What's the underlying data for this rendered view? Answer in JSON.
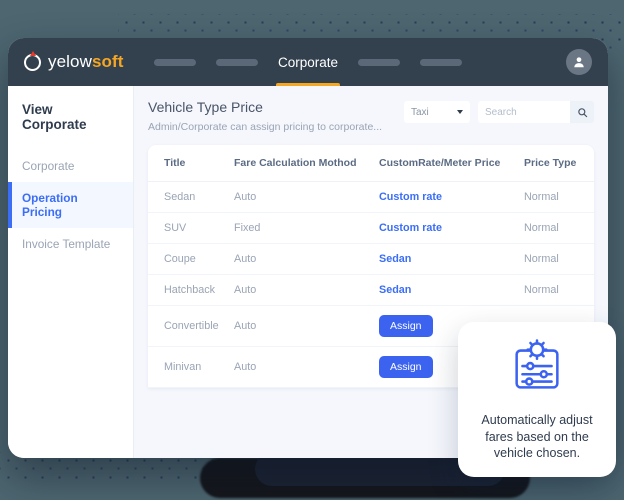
{
  "app": {
    "logo_primary": "yelow",
    "logo_accent": "soft",
    "logo_mark_icon": "circle-pin-icon",
    "accent_color": "#f5a623",
    "brand_blue": "#3b6ef5",
    "navbar_color": "#33414f",
    "page_background": "#4d6670"
  },
  "navbar": {
    "active_tab": "Corporate",
    "placeholder_tabs": [
      "",
      "",
      "",
      ""
    ],
    "avatar_icon": "user-avatar-icon"
  },
  "sidebar": {
    "title": "View Corporate",
    "items": [
      {
        "label": "Corporate",
        "active": false
      },
      {
        "label": "Operation Pricing",
        "active": true
      },
      {
        "label": "Invoice Template",
        "active": false
      }
    ]
  },
  "main": {
    "title": "Vehicle Type Price",
    "subtitle": "Admin/Corporate can assign pricing to corporate...",
    "filter": {
      "value": "Taxi",
      "icon": "chevron-down-icon"
    },
    "search": {
      "value": "",
      "placeholder": "Search",
      "icon": "search-icon"
    }
  },
  "table": {
    "columns": [
      "Title",
      "Fare Calculation Mothod",
      "CustomRate/Meter Price",
      "Price Type"
    ],
    "rows": [
      {
        "title": "Sedan",
        "method": "Auto",
        "rate": "Custom rate",
        "rate_kind": "link",
        "price_type": "Normal"
      },
      {
        "title": "SUV",
        "method": "Fixed",
        "rate": "Custom rate",
        "rate_kind": "link",
        "price_type": "Normal"
      },
      {
        "title": "Coupe",
        "method": "Auto",
        "rate": "Sedan",
        "rate_kind": "link",
        "price_type": "Normal"
      },
      {
        "title": "Hatchback",
        "method": "Auto",
        "rate": "Sedan",
        "rate_kind": "link",
        "price_type": "Normal"
      },
      {
        "title": "Convertible",
        "method": "Auto",
        "rate": "Assign",
        "rate_kind": "button",
        "price_type": ""
      },
      {
        "title": "Minivan",
        "method": "Auto",
        "rate": "Assign",
        "rate_kind": "button",
        "price_type": ""
      }
    ]
  },
  "feature_card": {
    "icon": "fare-settings-sliders-icon",
    "text": "Automatically adjust fares based on the vehicle chosen."
  }
}
